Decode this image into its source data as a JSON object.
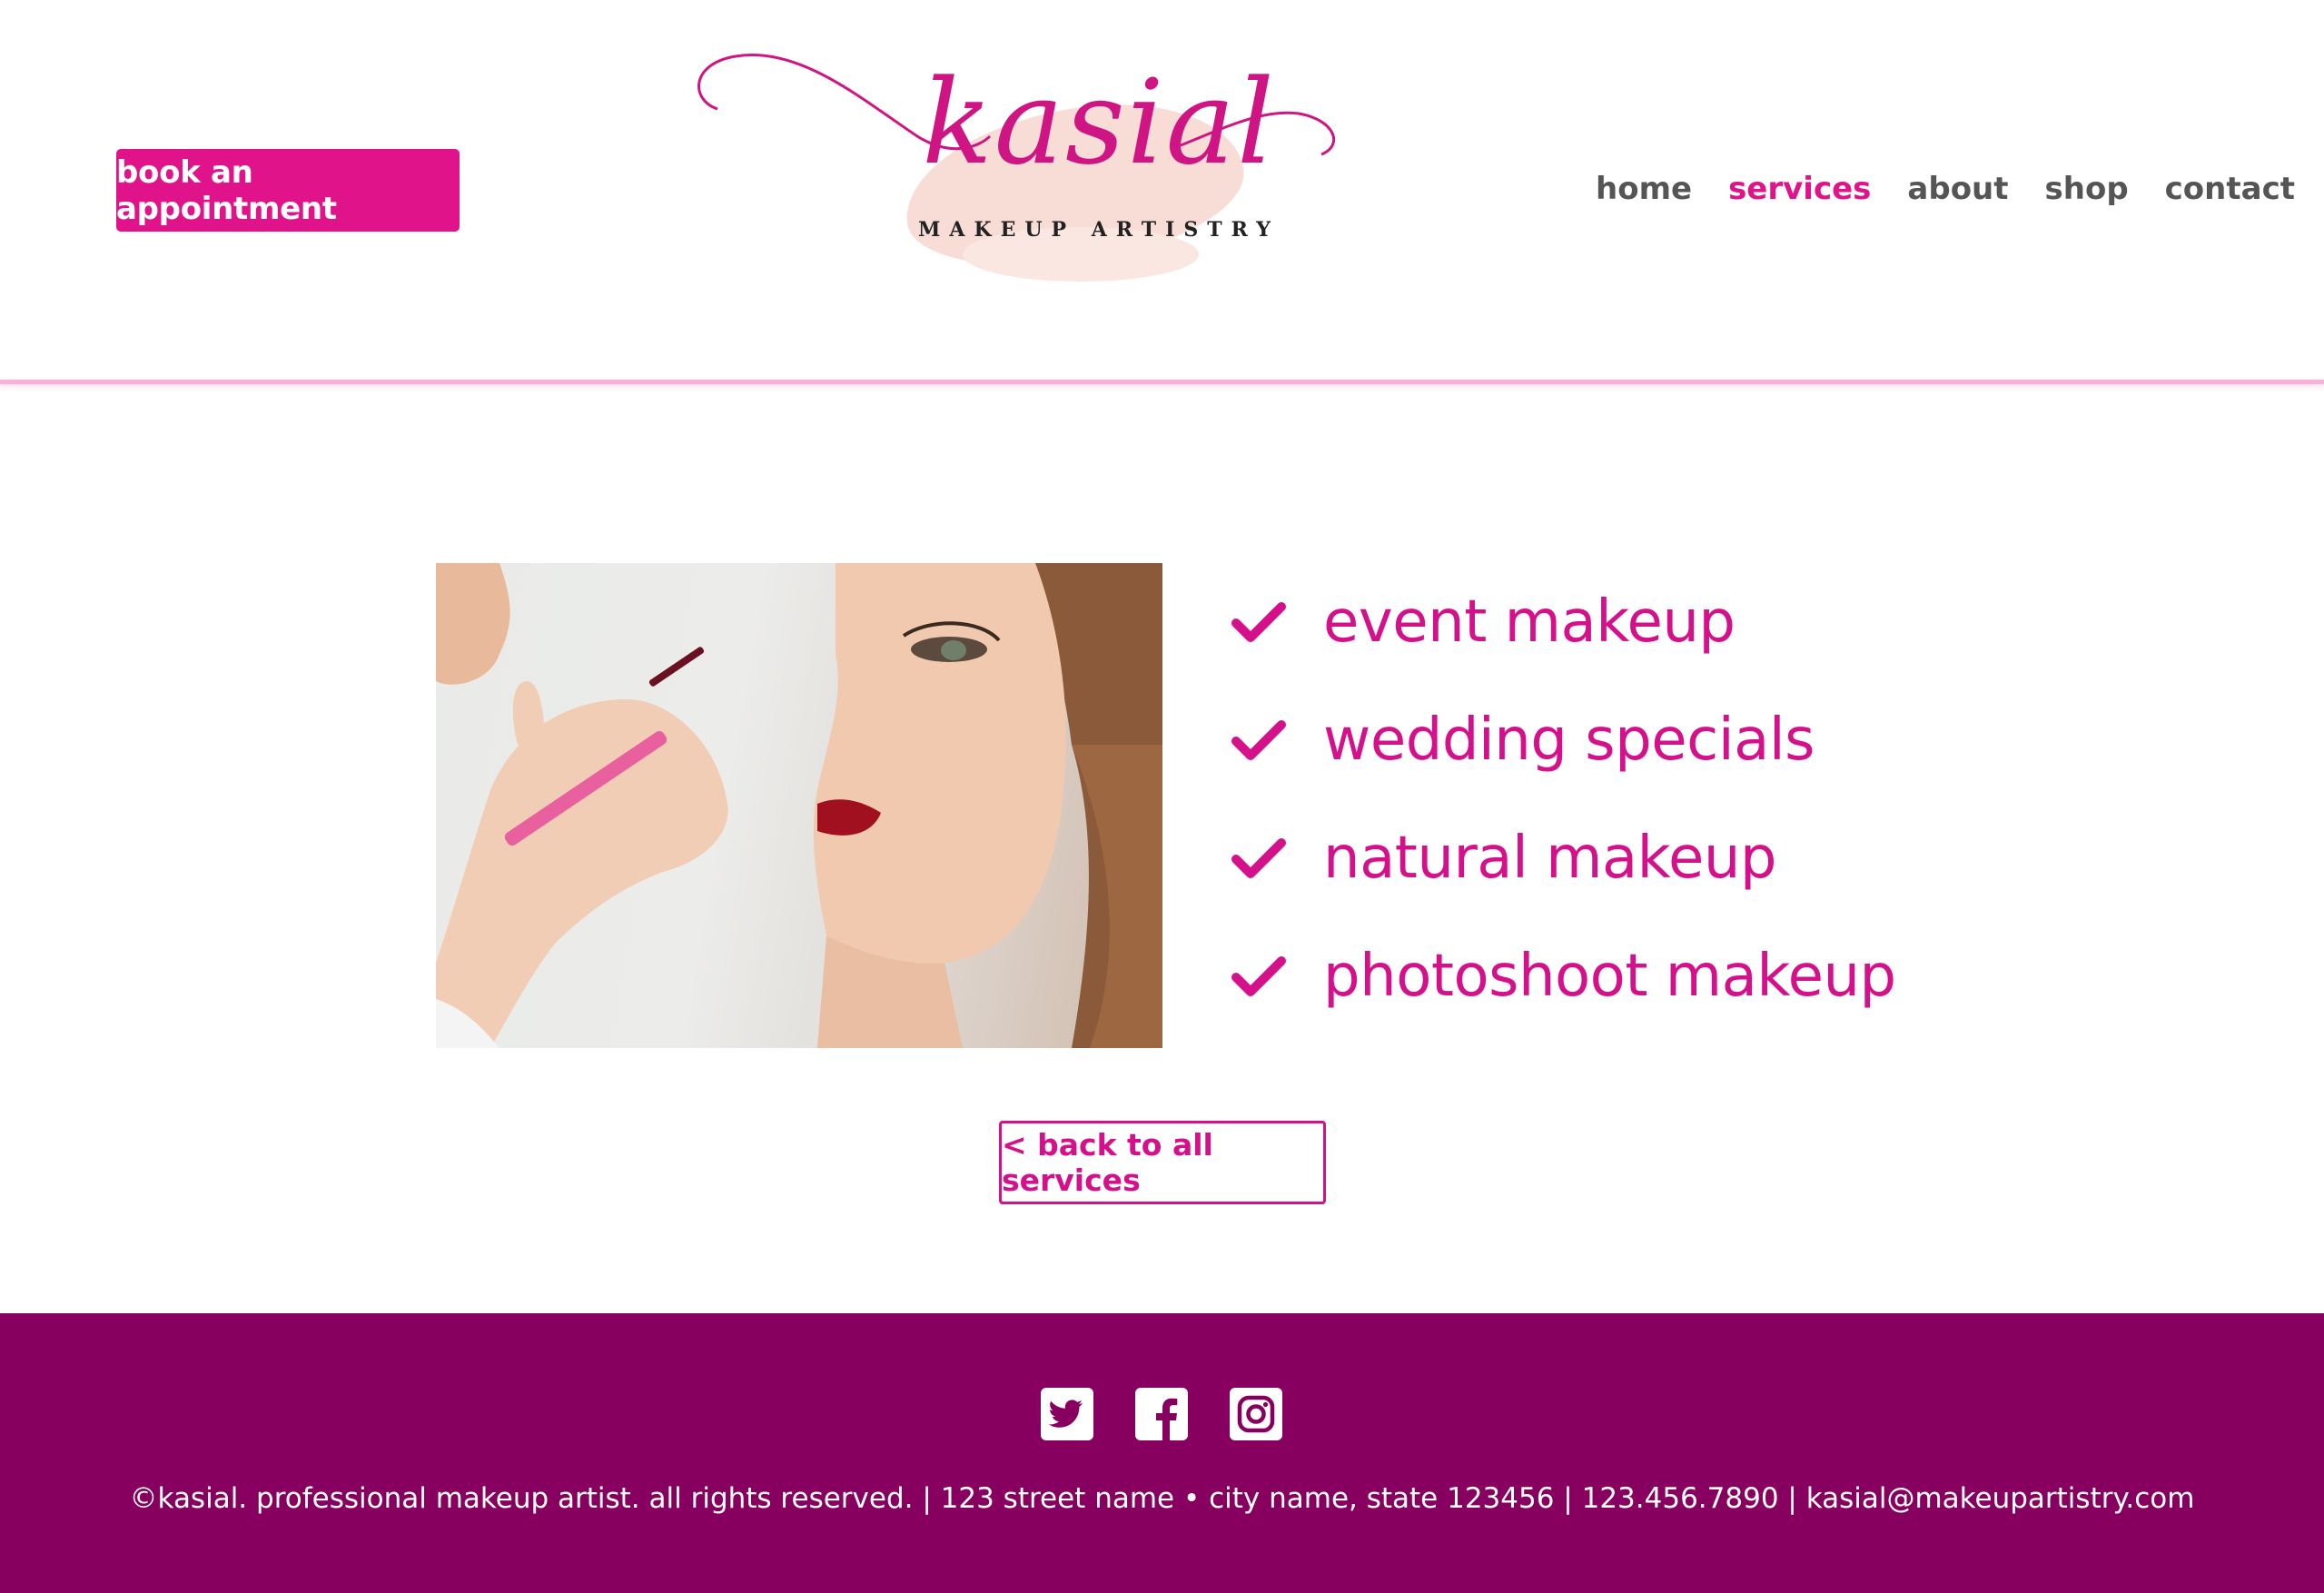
{
  "header": {
    "book_button": "book an appointment",
    "logo": {
      "name": "kasial",
      "tagline": "MAKEUP ARTISTRY"
    },
    "nav": [
      {
        "label": "home",
        "active": false
      },
      {
        "label": "services",
        "active": true
      },
      {
        "label": "about",
        "active": false
      },
      {
        "label": "shop",
        "active": false
      },
      {
        "label": "contact",
        "active": false
      }
    ]
  },
  "main": {
    "services": [
      {
        "label": "event makeup",
        "icon": "check-icon"
      },
      {
        "label": "wedding specials",
        "icon": "check-icon"
      },
      {
        "label": "natural makeup",
        "icon": "check-icon"
      },
      {
        "label": "photoshoot makeup",
        "icon": "check-icon"
      }
    ],
    "back_button": "< back to all services"
  },
  "footer": {
    "social": [
      "twitter-icon",
      "facebook-icon",
      "instagram-icon"
    ],
    "text": "©kasial. professional makeup artist. all rights reserved. | 123 street name • city name, state 123456 | 123.456.7890 | kasial@makeupartistry.com"
  },
  "colors": {
    "accent": "#e0138a",
    "footer_bg": "#870060",
    "header_line": "#f6b3d8"
  }
}
